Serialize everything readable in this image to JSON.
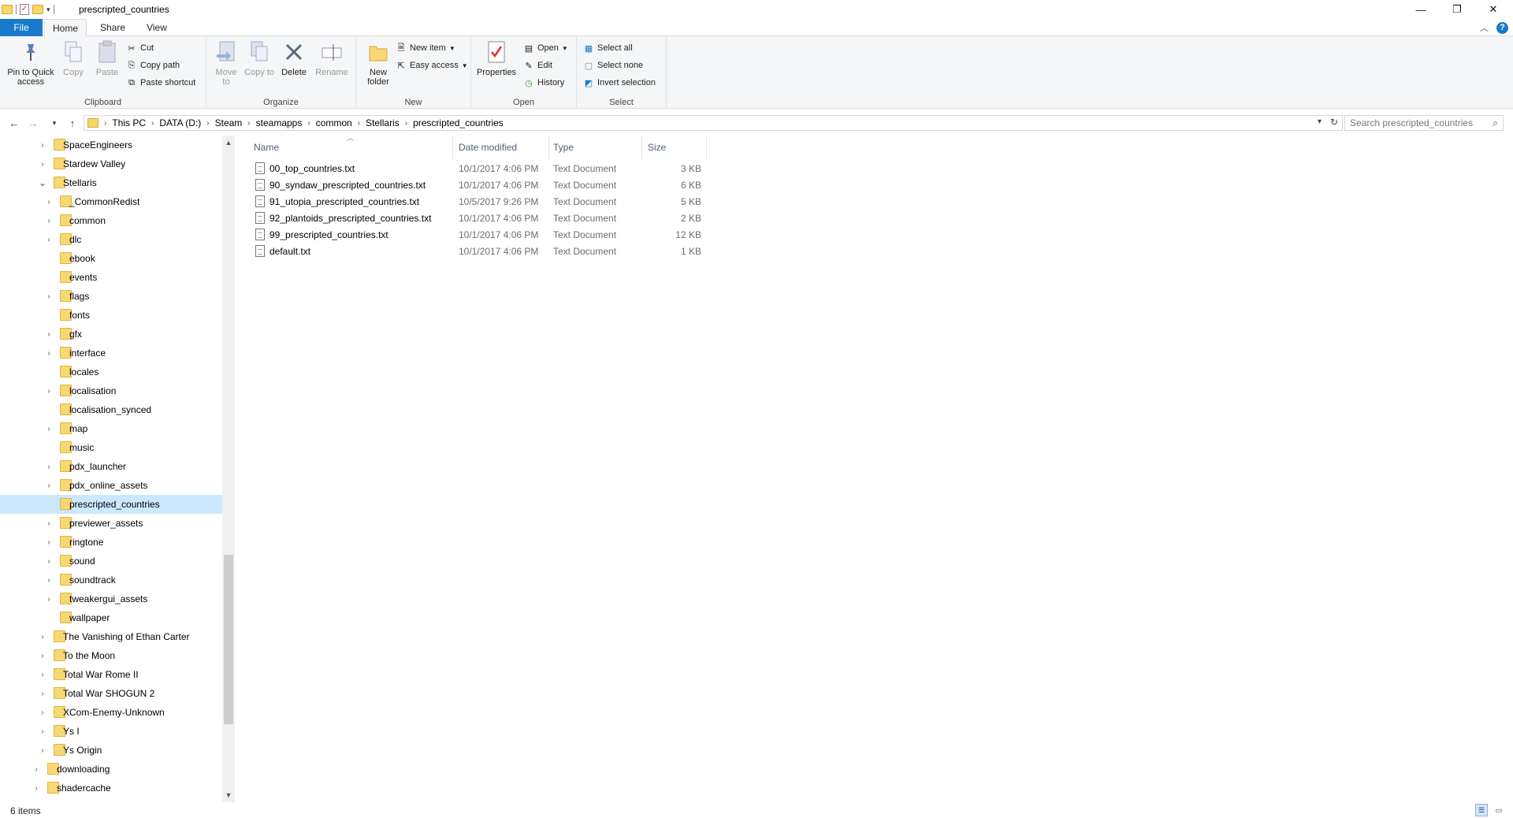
{
  "window": {
    "title": "prescripted_countries",
    "quick_access_dropdown": "▾",
    "minimize": "—",
    "maximize": "❐",
    "close": "✕"
  },
  "ribbon_tabs": {
    "file": "File",
    "home": "Home",
    "share": "Share",
    "view": "View",
    "collapse": "︿",
    "help": "?"
  },
  "ribbon": {
    "clipboard": {
      "label": "Clipboard",
      "pin": "Pin to Quick access",
      "copy": "Copy",
      "paste": "Paste",
      "cut": "Cut",
      "copy_path": "Copy path",
      "paste_shortcut": "Paste shortcut"
    },
    "organize": {
      "label": "Organize",
      "move_to": "Move to",
      "copy_to": "Copy to",
      "delete": "Delete",
      "rename": "Rename"
    },
    "new": {
      "label": "New",
      "new_folder": "New folder",
      "new_item": "New item",
      "easy_access": "Easy access"
    },
    "open": {
      "label": "Open",
      "properties": "Properties",
      "open": "Open",
      "edit": "Edit",
      "history": "History"
    },
    "select": {
      "label": "Select",
      "select_all": "Select all",
      "select_none": "Select none",
      "invert_selection": "Invert selection"
    }
  },
  "address": {
    "crumbs": [
      "This PC",
      "DATA (D:)",
      "Steam",
      "steamapps",
      "common",
      "Stellaris",
      "prescripted_countries"
    ],
    "search_placeholder": "Search prescripted_countries"
  },
  "nav_tree": [
    {
      "label": "SpaceEngineers",
      "expandable": true,
      "expanded": false,
      "level": 1
    },
    {
      "label": "Stardew Valley",
      "expandable": true,
      "expanded": false,
      "level": 1
    },
    {
      "label": "Stellaris",
      "expandable": true,
      "expanded": true,
      "level": 1
    },
    {
      "label": "_CommonRedist",
      "expandable": true,
      "expanded": false,
      "level": 2
    },
    {
      "label": "common",
      "expandable": true,
      "expanded": false,
      "level": 2
    },
    {
      "label": "dlc",
      "expandable": true,
      "expanded": false,
      "level": 2
    },
    {
      "label": "ebook",
      "expandable": false,
      "expanded": false,
      "level": 2
    },
    {
      "label": "events",
      "expandable": false,
      "expanded": false,
      "level": 2
    },
    {
      "label": "flags",
      "expandable": true,
      "expanded": false,
      "level": 2
    },
    {
      "label": "fonts",
      "expandable": false,
      "expanded": false,
      "level": 2
    },
    {
      "label": "gfx",
      "expandable": true,
      "expanded": false,
      "level": 2
    },
    {
      "label": "interface",
      "expandable": true,
      "expanded": false,
      "level": 2
    },
    {
      "label": "locales",
      "expandable": false,
      "expanded": false,
      "level": 2
    },
    {
      "label": "localisation",
      "expandable": true,
      "expanded": false,
      "level": 2
    },
    {
      "label": "localisation_synced",
      "expandable": false,
      "expanded": false,
      "level": 2
    },
    {
      "label": "map",
      "expandable": true,
      "expanded": false,
      "level": 2
    },
    {
      "label": "music",
      "expandable": false,
      "expanded": false,
      "level": 2
    },
    {
      "label": "pdx_launcher",
      "expandable": true,
      "expanded": false,
      "level": 2
    },
    {
      "label": "pdx_online_assets",
      "expandable": true,
      "expanded": false,
      "level": 2
    },
    {
      "label": "prescripted_countries",
      "expandable": false,
      "expanded": false,
      "level": 2,
      "selected": true
    },
    {
      "label": "previewer_assets",
      "expandable": true,
      "expanded": false,
      "level": 2
    },
    {
      "label": "ringtone",
      "expandable": true,
      "expanded": false,
      "level": 2
    },
    {
      "label": "sound",
      "expandable": true,
      "expanded": false,
      "level": 2
    },
    {
      "label": "soundtrack",
      "expandable": true,
      "expanded": false,
      "level": 2
    },
    {
      "label": "tweakergui_assets",
      "expandable": true,
      "expanded": false,
      "level": 2
    },
    {
      "label": "wallpaper",
      "expandable": false,
      "expanded": false,
      "level": 2
    },
    {
      "label": "The Vanishing of Ethan Carter",
      "expandable": true,
      "expanded": false,
      "level": 1
    },
    {
      "label": "To the Moon",
      "expandable": true,
      "expanded": false,
      "level": 1
    },
    {
      "label": "Total War Rome II",
      "expandable": true,
      "expanded": false,
      "level": 1
    },
    {
      "label": "Total War SHOGUN 2",
      "expandable": true,
      "expanded": false,
      "level": 1
    },
    {
      "label": "XCom-Enemy-Unknown",
      "expandable": true,
      "expanded": false,
      "level": 1
    },
    {
      "label": "Ys I",
      "expandable": true,
      "expanded": false,
      "level": 1
    },
    {
      "label": "Ys Origin",
      "expandable": true,
      "expanded": false,
      "level": 1
    },
    {
      "label": "downloading",
      "expandable": true,
      "expanded": false,
      "level": 0
    },
    {
      "label": "shadercache",
      "expandable": true,
      "expanded": false,
      "level": 0
    }
  ],
  "file_list": {
    "columns": {
      "name": "Name",
      "date": "Date modified",
      "type": "Type",
      "size": "Size"
    },
    "files": [
      {
        "name": "00_top_countries.txt",
        "date": "10/1/2017 4:06 PM",
        "type": "Text Document",
        "size": "3 KB"
      },
      {
        "name": "90_syndaw_prescripted_countries.txt",
        "date": "10/1/2017 4:06 PM",
        "type": "Text Document",
        "size": "6 KB"
      },
      {
        "name": "91_utopia_prescripted_countries.txt",
        "date": "10/5/2017 9:26 PM",
        "type": "Text Document",
        "size": "5 KB"
      },
      {
        "name": "92_plantoids_prescripted_countries.txt",
        "date": "10/1/2017 4:06 PM",
        "type": "Text Document",
        "size": "2 KB"
      },
      {
        "name": "99_prescripted_countries.txt",
        "date": "10/1/2017 4:06 PM",
        "type": "Text Document",
        "size": "12 KB"
      },
      {
        "name": "default.txt",
        "date": "10/1/2017 4:06 PM",
        "type": "Text Document",
        "size": "1 KB"
      }
    ]
  },
  "status": {
    "item_count": "6 items"
  },
  "colors": {
    "accent": "#1979ca",
    "selection": "#cce8ff",
    "folder": "#f8d775"
  }
}
